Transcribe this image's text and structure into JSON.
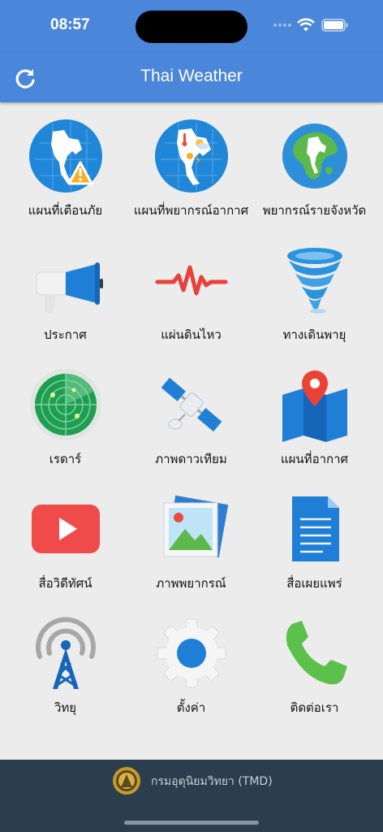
{
  "status": {
    "time": "08:57"
  },
  "app": {
    "title": "Thai Weather"
  },
  "menu": [
    {
      "label": "แผนที่เตือนภัย",
      "icon": "warning-map-icon"
    },
    {
      "label": "แผนที่พยากรณ์อากาศ",
      "icon": "forecast-map-icon"
    },
    {
      "label": "พยากรณ์รายจังหวัด",
      "icon": "globe-icon"
    },
    {
      "label": "ประกาศ",
      "icon": "megaphone-icon"
    },
    {
      "label": "แผ่นดินไหว",
      "icon": "earthquake-icon"
    },
    {
      "label": "ทางเดินพายุ",
      "icon": "tornado-icon"
    },
    {
      "label": "เรดาร์",
      "icon": "radar-icon"
    },
    {
      "label": "ภาพดาวเทียม",
      "icon": "satellite-icon"
    },
    {
      "label": "แผนที่อากาศ",
      "icon": "map-pin-icon"
    },
    {
      "label": "สื่อวิดีทัศน์",
      "icon": "video-play-icon"
    },
    {
      "label": "ภาพพยากรณ์",
      "icon": "picture-icon"
    },
    {
      "label": "สื่อเผยแพร่",
      "icon": "document-icon"
    },
    {
      "label": "วิทยุ",
      "icon": "radio-tower-icon"
    },
    {
      "label": "ตั้งค่า",
      "icon": "gear-icon"
    },
    {
      "label": "ติดต่อเรา",
      "icon": "phone-icon"
    }
  ],
  "footer": {
    "text": "กรมอุตุนิยมวิทยา (TMD)"
  },
  "colors": {
    "header": "#4a86d9",
    "footer": "#2c3e4d",
    "background": "#ececec"
  }
}
